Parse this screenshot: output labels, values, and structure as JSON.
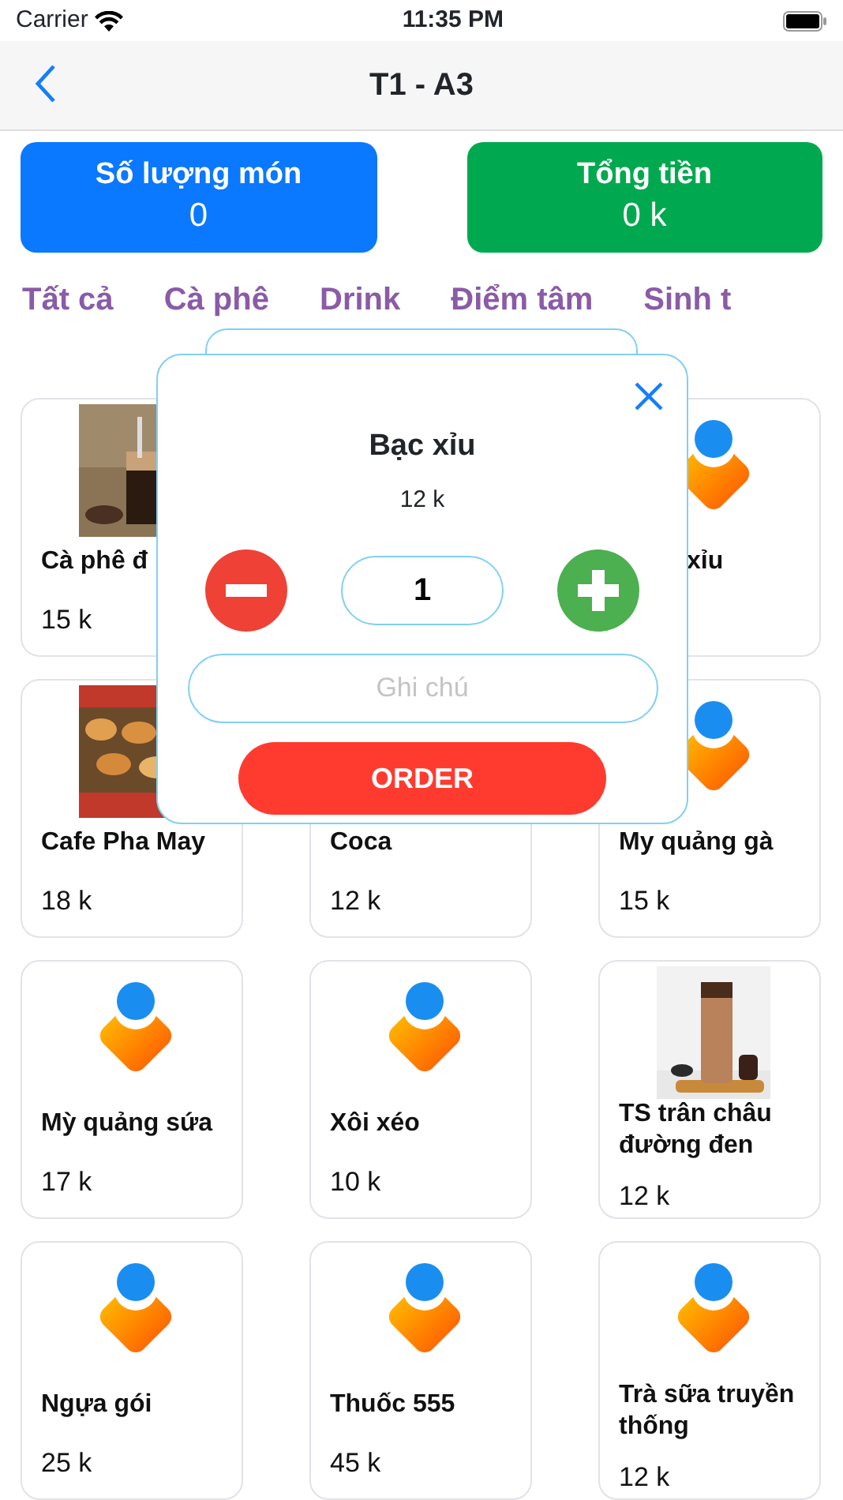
{
  "status_bar": {
    "carrier": "Carrier",
    "time": "11:35 PM"
  },
  "nav": {
    "title": "T1 - A3"
  },
  "summary": [
    {
      "kind": "count",
      "label": "Số lượng món",
      "value": "0"
    },
    {
      "kind": "total",
      "label": "Tổng tiền",
      "value": "0 k"
    }
  ],
  "categories": [
    "Tất cả",
    "Cà phê",
    "Drink",
    "Điểm tâm",
    "Sinh t"
  ],
  "products": [
    {
      "kind": "coffee-photo",
      "name": "Cà phê đ",
      "price": "15 k"
    },
    {
      "kind": "covered"
    },
    {
      "kind": "logo",
      "name": "xỉu",
      "name_covered": true
    },
    {
      "kind": "snack-photo",
      "name": "Cafe Pha May",
      "price": "18 k"
    },
    {
      "kind": "covered-image",
      "name": "Coca",
      "price": "12 k"
    },
    {
      "kind": "logo",
      "name": "My quảng gà",
      "price": "15 k"
    },
    {
      "kind": "logo",
      "name": "Mỳ quảng sứa",
      "price": "17 k"
    },
    {
      "kind": "logo",
      "name": "Xôi xéo",
      "price": "10 k"
    },
    {
      "kind": "tea-photo",
      "name": "TS trân châu đường đen",
      "price": "12 k"
    },
    {
      "kind": "logo",
      "name": "Ngựa gói",
      "price": "25 k"
    },
    {
      "kind": "logo",
      "name": "Thuốc 555",
      "price": "45 k"
    },
    {
      "kind": "logo",
      "name": "Trà sữa truyền thống",
      "price": "12 k"
    }
  ],
  "dialog": {
    "title": "Bạc xỉu",
    "price": "12 k",
    "quantity": "1",
    "note_placeholder": "Ghi chú",
    "order_button": "ORDER"
  }
}
